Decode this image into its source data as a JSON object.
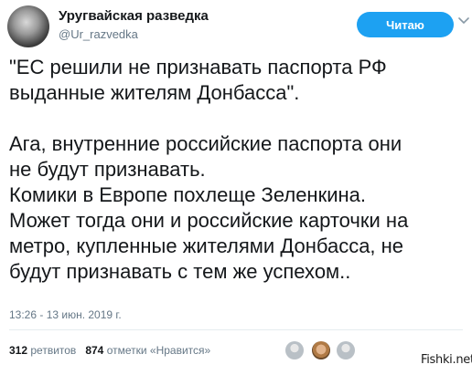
{
  "header": {
    "display_name": "Уругвайская разведка",
    "handle": "@Ur_razvedka",
    "follow_button_label": "Читаю"
  },
  "tweet": {
    "lines": [
      "\"ЕС решили не признавать паспорта РФ",
      "выданные жителям Донбасса\".",
      "Ага, внутренние российские паспорта они",
      "не будут признавать.",
      "Комики в Европе похлеще Зеленкина.",
      "Может тогда они и российские карточки на",
      "метро, купленные жителями Донбасса, не",
      "будут признавать с тем же успехом.."
    ],
    "timestamp": "13:26 - 13 июн. 2019 г."
  },
  "stats": {
    "retweets_count": "312",
    "retweets_label": "ретвитов",
    "likes_count": "874",
    "likes_label": "отметки «Нравится»"
  },
  "watermark": "Fishki.net",
  "icons": {
    "more": "chevron-down-icon"
  },
  "colors": {
    "follow_button": "#1da1f2",
    "secondary_text": "#657786",
    "primary_text": "#14171a"
  }
}
